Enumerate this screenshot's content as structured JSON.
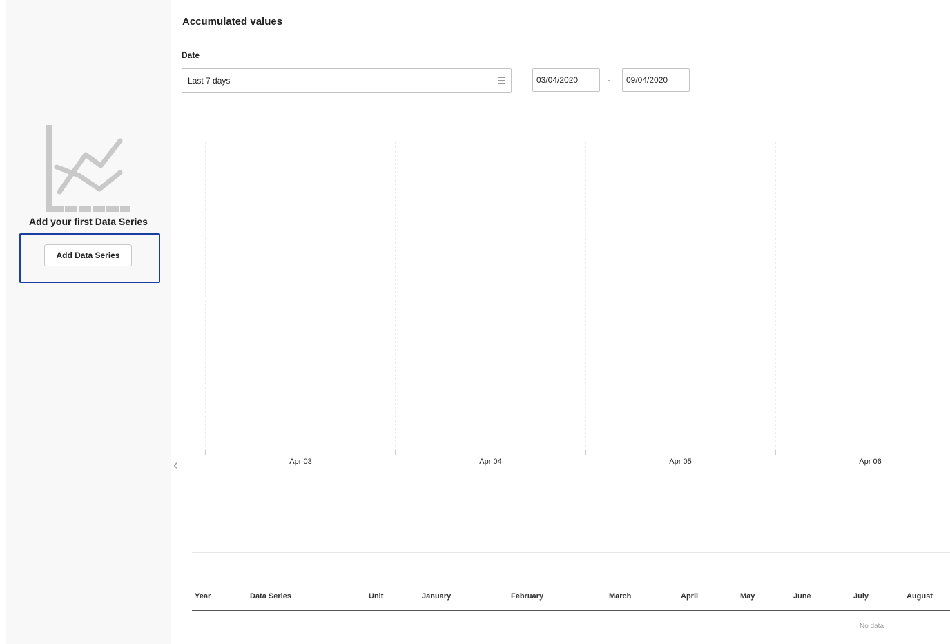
{
  "sidebar": {
    "empty_icon": "line-chart-icon",
    "empty_text": "Add your first Data Series",
    "add_button_label": "Add Data Series",
    "collapse_icon": "chevron-left-icon",
    "highlight_color": "#1b3fa0"
  },
  "main": {
    "title": "Accumulated values",
    "date_label": "Date",
    "date_range_select": {
      "value": "Last 7 days",
      "icon": "menu-lines-icon"
    },
    "start_date": "03/04/2020",
    "end_date": "09/04/2020",
    "date_separator": "-"
  },
  "chart_data": {
    "type": "line",
    "x": [
      "Apr 03",
      "Apr 04",
      "Apr 05",
      "Apr 06"
    ],
    "series": [],
    "grid": "vertical dashed",
    "title": "",
    "xlabel": "",
    "ylabel": ""
  },
  "table": {
    "columns": [
      "Year",
      "Data Series",
      "Unit",
      "January",
      "February",
      "March",
      "April",
      "May",
      "June",
      "July",
      "August"
    ],
    "rows": [],
    "empty_text": "No data"
  }
}
